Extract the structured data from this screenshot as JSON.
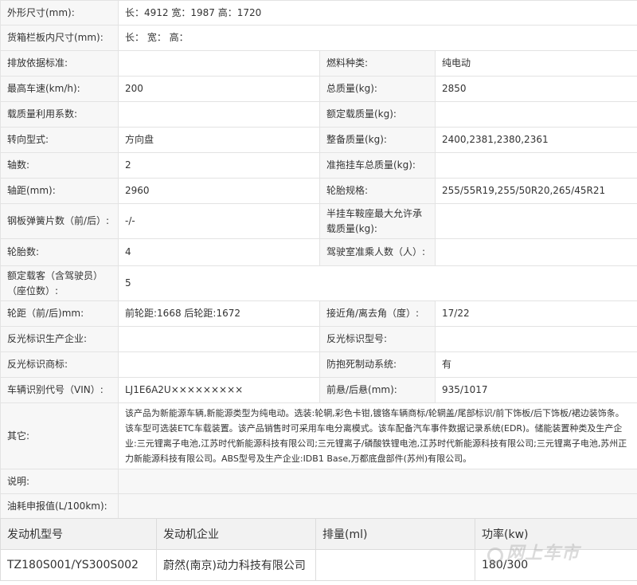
{
  "spec_rows": [
    {
      "cells": [
        {
          "label": "外形尺寸(mm):",
          "value": "长：4912 宽：1987 高：1720"
        }
      ]
    },
    {
      "cells": [
        {
          "label": "货箱栏板内尺寸(mm):",
          "value": "长：  宽：  高："
        }
      ]
    },
    {
      "cells": [
        {
          "label": "排放依据标准:",
          "value": ""
        },
        {
          "label": "燃料种类:",
          "value": "纯电动"
        }
      ]
    },
    {
      "cells": [
        {
          "label": "最高车速(km/h):",
          "value": "200"
        },
        {
          "label": "总质量(kg):",
          "value": "2850"
        }
      ]
    },
    {
      "cells": [
        {
          "label": "载质量利用系数:",
          "value": ""
        },
        {
          "label": "额定载质量(kg):",
          "value": ""
        }
      ]
    },
    {
      "cells": [
        {
          "label": "转向型式:",
          "value": "方向盘"
        },
        {
          "label": "整备质量(kg):",
          "value": "2400,2381,2380,2361"
        }
      ]
    },
    {
      "cells": [
        {
          "label": "轴数:",
          "value": "2"
        },
        {
          "label": "准拖挂车总质量(kg):",
          "value": ""
        }
      ]
    },
    {
      "cells": [
        {
          "label": "轴距(mm):",
          "value": "2960"
        },
        {
          "label": "轮胎规格:",
          "value": "255/55R19,255/50R20,265/45R21"
        }
      ]
    },
    {
      "cells": [
        {
          "label": "钢板弹簧片数（前/后）:",
          "value": "-/-"
        },
        {
          "label": "半挂车鞍座最大允许承载质量(kg):",
          "value": ""
        }
      ]
    },
    {
      "cells": [
        {
          "label": "轮胎数:",
          "value": "4"
        },
        {
          "label": "驾驶室准乘人数（人）:",
          "value": ""
        }
      ]
    },
    {
      "cells": [
        {
          "label": "额定载客（含驾驶员）（座位数）:",
          "value": "5"
        }
      ]
    },
    {
      "cells": [
        {
          "label": "轮距（前/后)mm:",
          "value": "前轮距:1668 后轮距:1672"
        },
        {
          "label": "接近角/离去角（度）:",
          "value": "17/22"
        }
      ]
    },
    {
      "cells": [
        {
          "label": "反光标识生产企业:",
          "value": ""
        },
        {
          "label": "反光标识型号:",
          "value": ""
        }
      ]
    },
    {
      "cells": [
        {
          "label": "反光标识商标:",
          "value": ""
        },
        {
          "label": "防抱死制动系统:",
          "value": "有"
        }
      ]
    },
    {
      "cells": [
        {
          "label": "车辆识别代号（VIN）:",
          "value": "LJ1E6A2U×××××××××"
        },
        {
          "label": "前悬/后悬(mm):",
          "value": "935/1017"
        }
      ]
    },
    {
      "cells": [
        {
          "label": "其它:",
          "value": "该产品为新能源车辆,新能源类型为纯电动。选装:轮辋,彩色卡钳,镀铬车辆商标/轮辋盖/尾部标识/前下饰板/后下饰板/裙边装饰条。该车型可选装ETC车载装置。该产品销售时可采用车电分离模式。该车配备汽车事件数据记录系统(EDR)。储能装置种类及生产企业:三元锂离子电池,江苏时代新能源科技有限公司;三元锂离子/磷酸铁锂电池,江苏时代新能源科技有限公司;三元锂离子电池,苏州正力新能源科技有限公司。ABS型号及生产企业:IDB1 Base,万都底盘部件(苏州)有限公司。"
        }
      ]
    },
    {
      "cells": [
        {
          "label": "说明:",
          "value": ""
        }
      ]
    },
    {
      "cells": [
        {
          "label": "油耗申报值(L/100km):",
          "value": ""
        }
      ]
    }
  ],
  "engine_table": {
    "headers": [
      "发动机型号",
      "发动机企业",
      "排量(ml)",
      "功率(kw)"
    ],
    "row": [
      "TZ180S001/YS300S002",
      "蔚然(南京)动力科技有限公司",
      "",
      "180/300"
    ]
  },
  "watermark": {
    "text": "网上车市"
  }
}
